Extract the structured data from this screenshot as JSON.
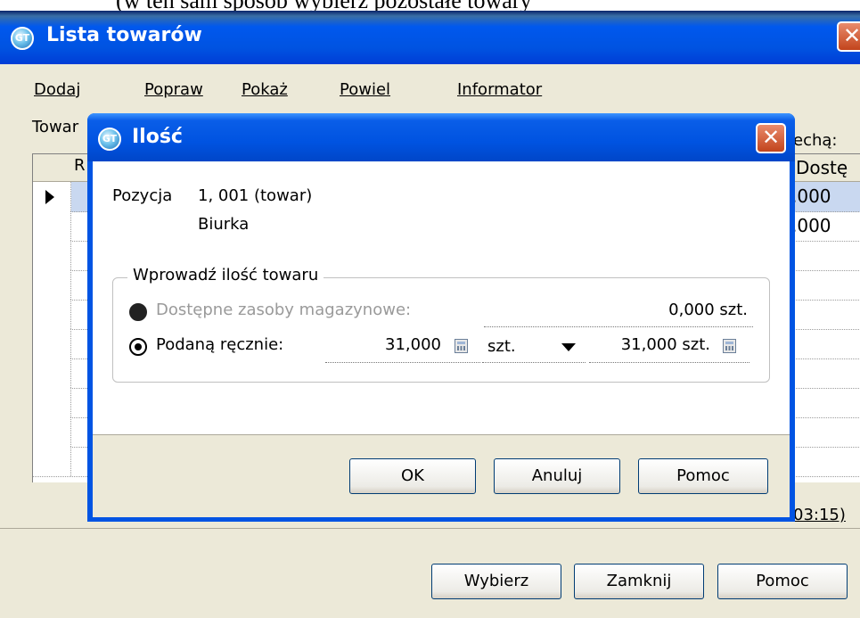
{
  "top_caption": "(w ten sam sposób wybierz pozostałe towary",
  "main_window": {
    "title": "Lista towarów",
    "close_label": "✕",
    "menu": [
      "Dodaj",
      "Popraw",
      "Pokaż",
      "Powiel",
      "Informator"
    ],
    "towar_label": "Towar",
    "cecha_label": "echą:",
    "grid": {
      "col_r": "R",
      "col_dost": "Dostę",
      "rows": [
        ",000",
        ",000"
      ]
    },
    "footer_text": "03:15)",
    "buttons": {
      "select": "Wybierz",
      "close": "Zamknij",
      "help": "Pomoc"
    }
  },
  "dialog": {
    "title": "Ilość",
    "close_label": "✕",
    "position_label": "Pozycja",
    "position_value": "1, 001 (towar)",
    "position_name": "Biurka",
    "group_title": "Wprowadź ilość towaru",
    "option_available": {
      "label": "Dostępne zasoby magazynowe:",
      "value": "0,000 szt.",
      "selected": false,
      "disabled": true
    },
    "option_manual": {
      "label": "Podaną ręcznie:",
      "quantity": "31,000",
      "unit": "szt.",
      "total": "31,000 szt.",
      "selected": true
    },
    "buttons": {
      "ok": "OK",
      "cancel": "Anuluj",
      "help": "Pomoc"
    }
  },
  "colors": {
    "titlebar": "#0054e3",
    "close": "#d9582e",
    "face": "#ece9d8"
  },
  "icons": {
    "app": "gt-app-icon",
    "calculator": "calculator-icon",
    "dropdown": "chevron-down-icon",
    "row_pointer": "row-pointer-icon"
  }
}
